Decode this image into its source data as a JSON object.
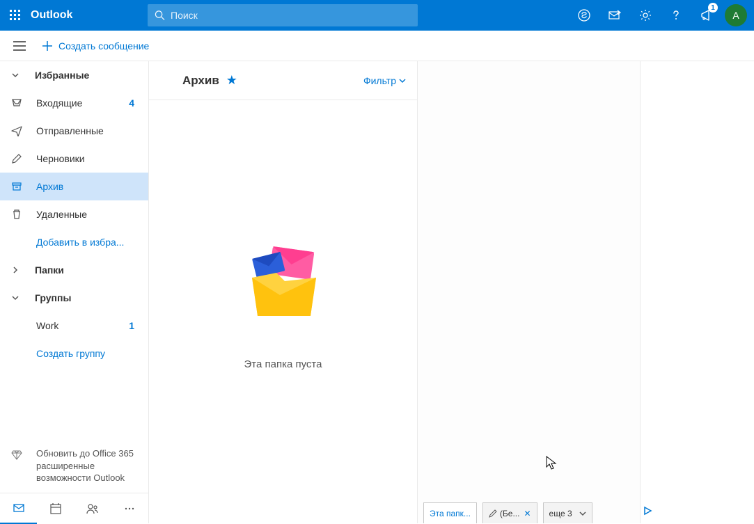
{
  "header": {
    "brand": "Outlook",
    "search_placeholder": "Поиск",
    "notif_badge": "1",
    "avatar_initial": "A"
  },
  "subheader": {
    "compose": "Создать сообщение"
  },
  "sidebar": {
    "favorites_head": "Избранные",
    "items": [
      {
        "label": "Входящие",
        "count": "4"
      },
      {
        "label": "Отправленные"
      },
      {
        "label": "Черновики"
      },
      {
        "label": "Архив"
      },
      {
        "label": "Удаленные"
      }
    ],
    "add_fav": "Добавить в избра...",
    "folders_head": "Папки",
    "groups_head": "Группы",
    "groups": [
      {
        "label": "Work",
        "count": "1"
      }
    ],
    "new_group": "Создать группу",
    "upgrade": "Обновить до Office 365 расширенные возможности Outlook"
  },
  "list": {
    "title": "Архив",
    "filter": "Фильтр",
    "empty_msg": "Эта папка пуста"
  },
  "tabs": {
    "t0": "Эта папк...",
    "t1": "(Бе...",
    "more": "еще 3"
  }
}
